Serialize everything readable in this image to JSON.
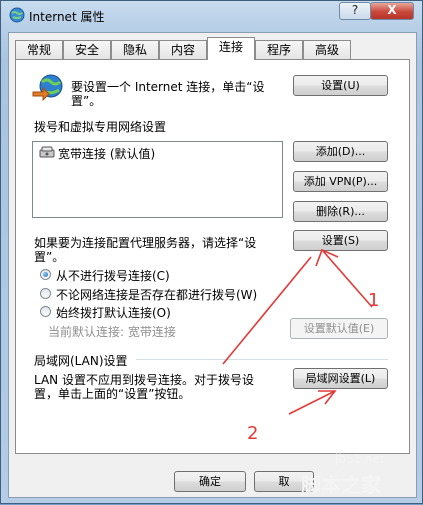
{
  "window": {
    "title": "Internet 属性",
    "help_label": "?",
    "close_label": "X"
  },
  "tabs": [
    {
      "label": "常规"
    },
    {
      "label": "安全"
    },
    {
      "label": "隐私"
    },
    {
      "label": "内容"
    },
    {
      "label": "连接"
    },
    {
      "label": "程序"
    },
    {
      "label": "高级"
    }
  ],
  "active_tab": "连接",
  "setup": {
    "text_line1": "要设置一个 Internet 连接，单击“设",
    "text_line2": "置”。",
    "button": "设置(U)"
  },
  "dialup": {
    "heading": "拨号和虚拟专用网络设置",
    "list_item": "宽带连接 (默认值)",
    "add_button": "添加(D)...",
    "add_vpn_button": "添加 VPN(P)...",
    "delete_button": "删除(R)...",
    "proxy_text_line1": "如果要为连接配置代理服务器，请选择“设",
    "proxy_text_line2": "置”。",
    "settings_button": "设置(S)",
    "radio_never": "从不进行拨号连接(C)",
    "radio_when_no_network": "不论网络连接是否存在都进行拨号(W)",
    "radio_always": "始终拨打默认连接(O)",
    "current_default": "当前默认连接: 宽带连接",
    "set_default_button": "设置默认值(E)"
  },
  "lan": {
    "heading": "局域网(LAN)设置",
    "text_line1": "LAN 设置不应用到拨号连接。对于拨号设",
    "text_line2": "置，单击上面的“设置”按钮。",
    "button": "局域网设置(L)"
  },
  "footer": {
    "ok_button": "确定",
    "cancel_button": "取"
  },
  "annotations": {
    "num1": "1",
    "num2": "2",
    "color": "#e23a36"
  },
  "watermark": {
    "site": "jb51.net",
    "name": "脚本之家"
  }
}
